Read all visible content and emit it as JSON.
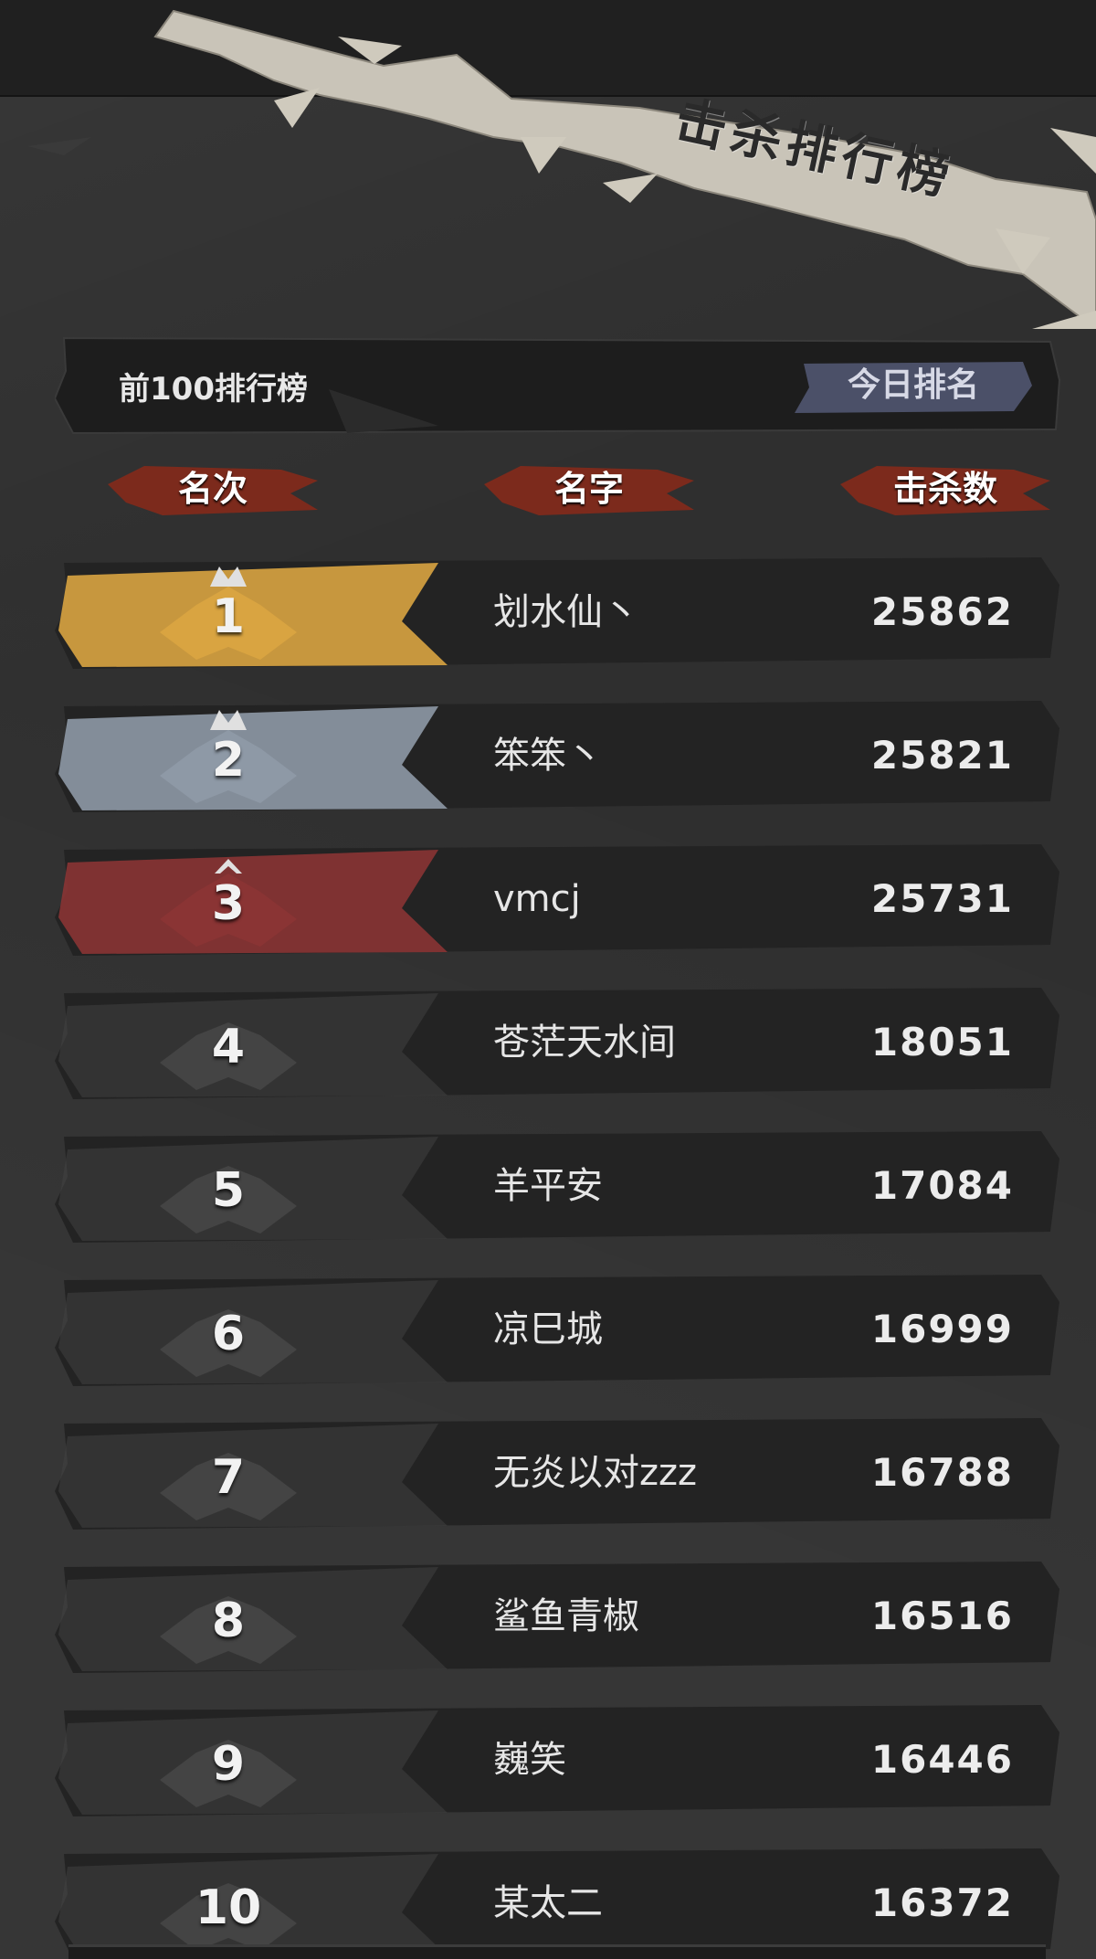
{
  "banner": {
    "title": "击杀排行榜"
  },
  "tabs": {
    "top100_label": "前100排行榜",
    "today_label": "今日排名"
  },
  "columns": {
    "rank": "名次",
    "name": "名字",
    "kills": "击杀数"
  },
  "colors": {
    "gold": "#d9a441",
    "silver": "#8e99a6",
    "bronze": "#8a3434",
    "plain": "#444444",
    "row_bg": "#232323",
    "header_accent": "#a8341f",
    "today_tab": "#4b5068"
  },
  "rows": [
    {
      "rank": "1",
      "name": "划水仙丶",
      "kills": "25862",
      "tier": "gold"
    },
    {
      "rank": "2",
      "name": "笨笨丶",
      "kills": "25821",
      "tier": "silver"
    },
    {
      "rank": "3",
      "name": "vmcj",
      "kills": "25731",
      "tier": "bronze"
    },
    {
      "rank": "4",
      "name": "苍茫天水间",
      "kills": "18051",
      "tier": "plain"
    },
    {
      "rank": "5",
      "name": "羊平安",
      "kills": "17084",
      "tier": "plain"
    },
    {
      "rank": "6",
      "name": "凉巳城",
      "kills": "16999",
      "tier": "plain"
    },
    {
      "rank": "7",
      "name": "无炎以对zzz",
      "kills": "16788",
      "tier": "plain"
    },
    {
      "rank": "8",
      "name": "鲨鱼青椒",
      "kills": "16516",
      "tier": "plain"
    },
    {
      "rank": "9",
      "name": "巍笑",
      "kills": "16446",
      "tier": "plain"
    },
    {
      "rank": "10",
      "name": "某太二",
      "kills": "16372",
      "tier": "plain"
    }
  ]
}
